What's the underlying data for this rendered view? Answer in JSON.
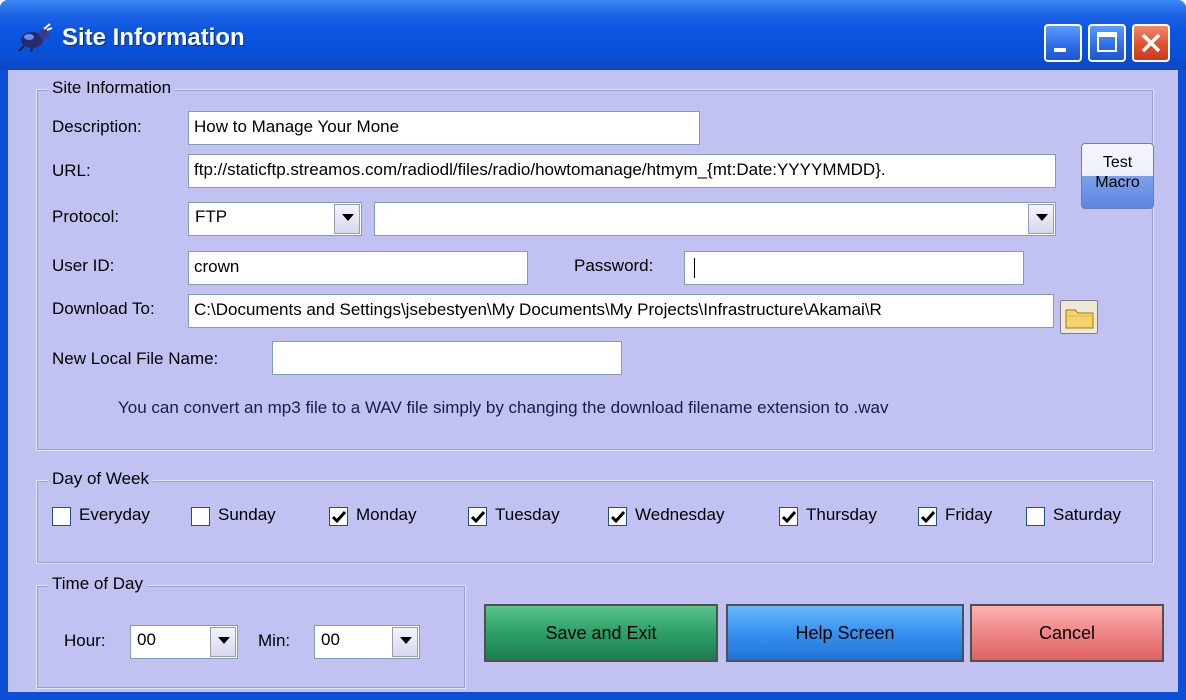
{
  "window": {
    "title": "Site Information"
  },
  "site_group": {
    "legend": "Site Information",
    "description_label": "Description:",
    "description_value": "How to Manage Your Mone",
    "url_label": "URL:",
    "url_value": "ftp://staticftp.streamos.com/radiodl/files/radio/howtomanage/htmym_{mt:Date:YYYYMMDD}.",
    "test_macro_line1": "Test",
    "test_macro_line2": "Macro",
    "protocol_label": "Protocol:",
    "protocol_value": "FTP",
    "protocol_extra_value": "",
    "userid_label": "User ID:",
    "userid_value": "crown",
    "password_label": "Password:",
    "password_value": "",
    "download_label": "Download To:",
    "download_value": "C:\\Documents and Settings\\jsebestyen\\My Documents\\My Projects\\Infrastructure\\Akamai\\R",
    "localname_label": "New Local File Name:",
    "localname_value": "",
    "info_text": "You can convert an mp3 file to a WAV file simply by changing the download filename extension to .wav"
  },
  "day_group": {
    "legend": "Day of Week",
    "days": [
      {
        "label": "Everyday",
        "checked": false
      },
      {
        "label": "Sunday",
        "checked": false
      },
      {
        "label": "Monday",
        "checked": true
      },
      {
        "label": "Tuesday",
        "checked": true
      },
      {
        "label": "Wednesday",
        "checked": true
      },
      {
        "label": "Thursday",
        "checked": true
      },
      {
        "label": "Friday",
        "checked": true
      },
      {
        "label": "Saturday",
        "checked": false
      }
    ]
  },
  "time_group": {
    "legend": "Time of Day",
    "hour_label": "Hour:",
    "hour_value": "00",
    "min_label": "Min:",
    "min_value": "00"
  },
  "actions": {
    "save_label": "Save and Exit",
    "help_label": "Help Screen",
    "cancel_label": "Cancel"
  },
  "colors": {
    "titlebar": "#0a55e0",
    "client": "#c2c2f2",
    "save": "#2fa36a",
    "help": "#3a95f0",
    "cancel": "#f08a8a"
  },
  "icons": [
    "app-bug-icon",
    "minimize-icon",
    "maximize-icon",
    "close-icon",
    "dropdown-arrow-icon",
    "folder-icon",
    "checkmark-icon"
  ]
}
